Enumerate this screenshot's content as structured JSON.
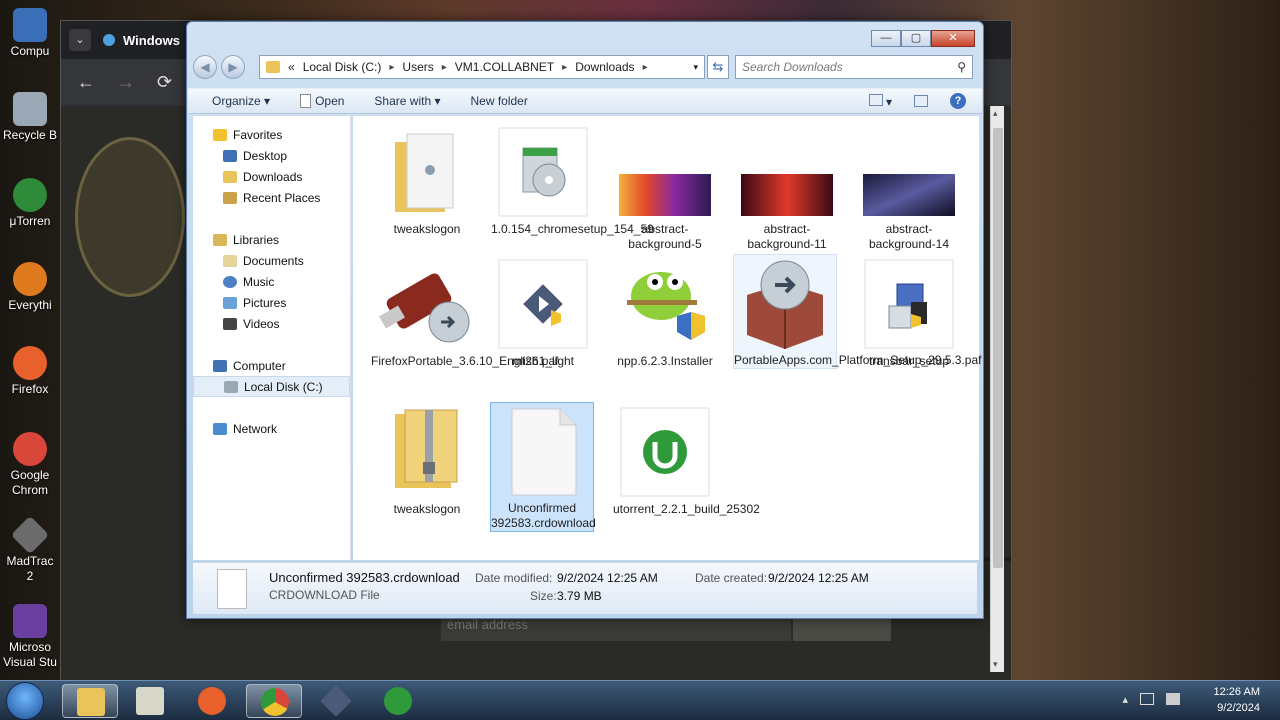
{
  "desktop": {
    "icons": [
      {
        "label": "Compu",
        "color": "#3a6fb8"
      },
      {
        "label": "Recycle B",
        "color": "#9aa7b5"
      },
      {
        "label": "μTorren",
        "color": "#2e8b3a"
      },
      {
        "label": "Everythi",
        "color": "#e07a1e"
      },
      {
        "label": "Firefox",
        "color": "#e8612c"
      },
      {
        "label": "Google",
        "label2": "Chrom",
        "color": "#d9463a"
      },
      {
        "label": "MadTrac",
        "label2": "2",
        "color": "#6b6b6b"
      },
      {
        "label": "Microso",
        "label2": "Visual Stu",
        "color": "#6b3fa0"
      }
    ]
  },
  "browser": {
    "tab_title": "Windows",
    "tab_menu": "⌄",
    "nav": {
      "back": "←",
      "forward": "→",
      "reload": "⟳"
    },
    "email_placeholder": "email address"
  },
  "explorer": {
    "window_controls": {
      "minimize": "—",
      "maximize": "▢",
      "close": "✕"
    },
    "nav_back": "◀",
    "nav_forward": "▶",
    "breadcrumb": {
      "overflow": "«",
      "parts": [
        "Local Disk (C:)",
        "Users",
        "VM1.COLLABNET",
        "Downloads"
      ],
      "separator": "▸",
      "dropdown": "▾"
    },
    "refresh_icon": "⇆",
    "search": {
      "placeholder": "Search Downloads",
      "icon": "⚲"
    },
    "toolbar": {
      "organize": "Organize ▾",
      "open": "Open",
      "share_with": "Share with ▾",
      "new_folder": "New folder",
      "view_dropdown": "▾",
      "help": "?"
    },
    "nav_pane": {
      "favorites": "Favorites",
      "desktop": "Desktop",
      "downloads": "Downloads",
      "recent_places": "Recent Places",
      "libraries": "Libraries",
      "documents": "Documents",
      "music": "Music",
      "pictures": "Pictures",
      "videos": "Videos",
      "computer": "Computer",
      "local_disk": "Local Disk (C:)",
      "network": "Network"
    },
    "files": [
      {
        "name": "tweakslogon"
      },
      {
        "name": "1.0.154_chromesetup_154_59"
      },
      {
        "name": "abstract-background-5"
      },
      {
        "name": "abstract-background-11"
      },
      {
        "name": "abstract-background-14"
      },
      {
        "name": "FirefoxPortable_3.6.10_English.paf"
      },
      {
        "name": "mt261_light"
      },
      {
        "name": "npp.6.2.3.Installer"
      },
      {
        "name": "PortableApps.com_Platform_Setup_29.5.3.paf"
      },
      {
        "name": "transbar_setup"
      },
      {
        "name": "tweakslogon"
      },
      {
        "name": "Unconfirmed 392583.crdownload"
      },
      {
        "name": "utorrent_2.2.1_build_25302"
      }
    ],
    "details": {
      "filename": "Unconfirmed 392583.crdownload",
      "filetype": "CRDOWNLOAD File",
      "date_modified_label": "Date modified:",
      "date_modified": "9/2/2024 12:25 AM",
      "date_created_label": "Date created:",
      "date_created": "9/2/2024 12:25 AM",
      "size_label": "Size:",
      "size": "3.79 MB"
    }
  },
  "taskbar": {
    "clock_time": "12:26 AM",
    "clock_date": "9/2/2024",
    "tray": {
      "show_hidden": "▴"
    },
    "scroll_up": "▴",
    "scroll_down": "▾"
  }
}
